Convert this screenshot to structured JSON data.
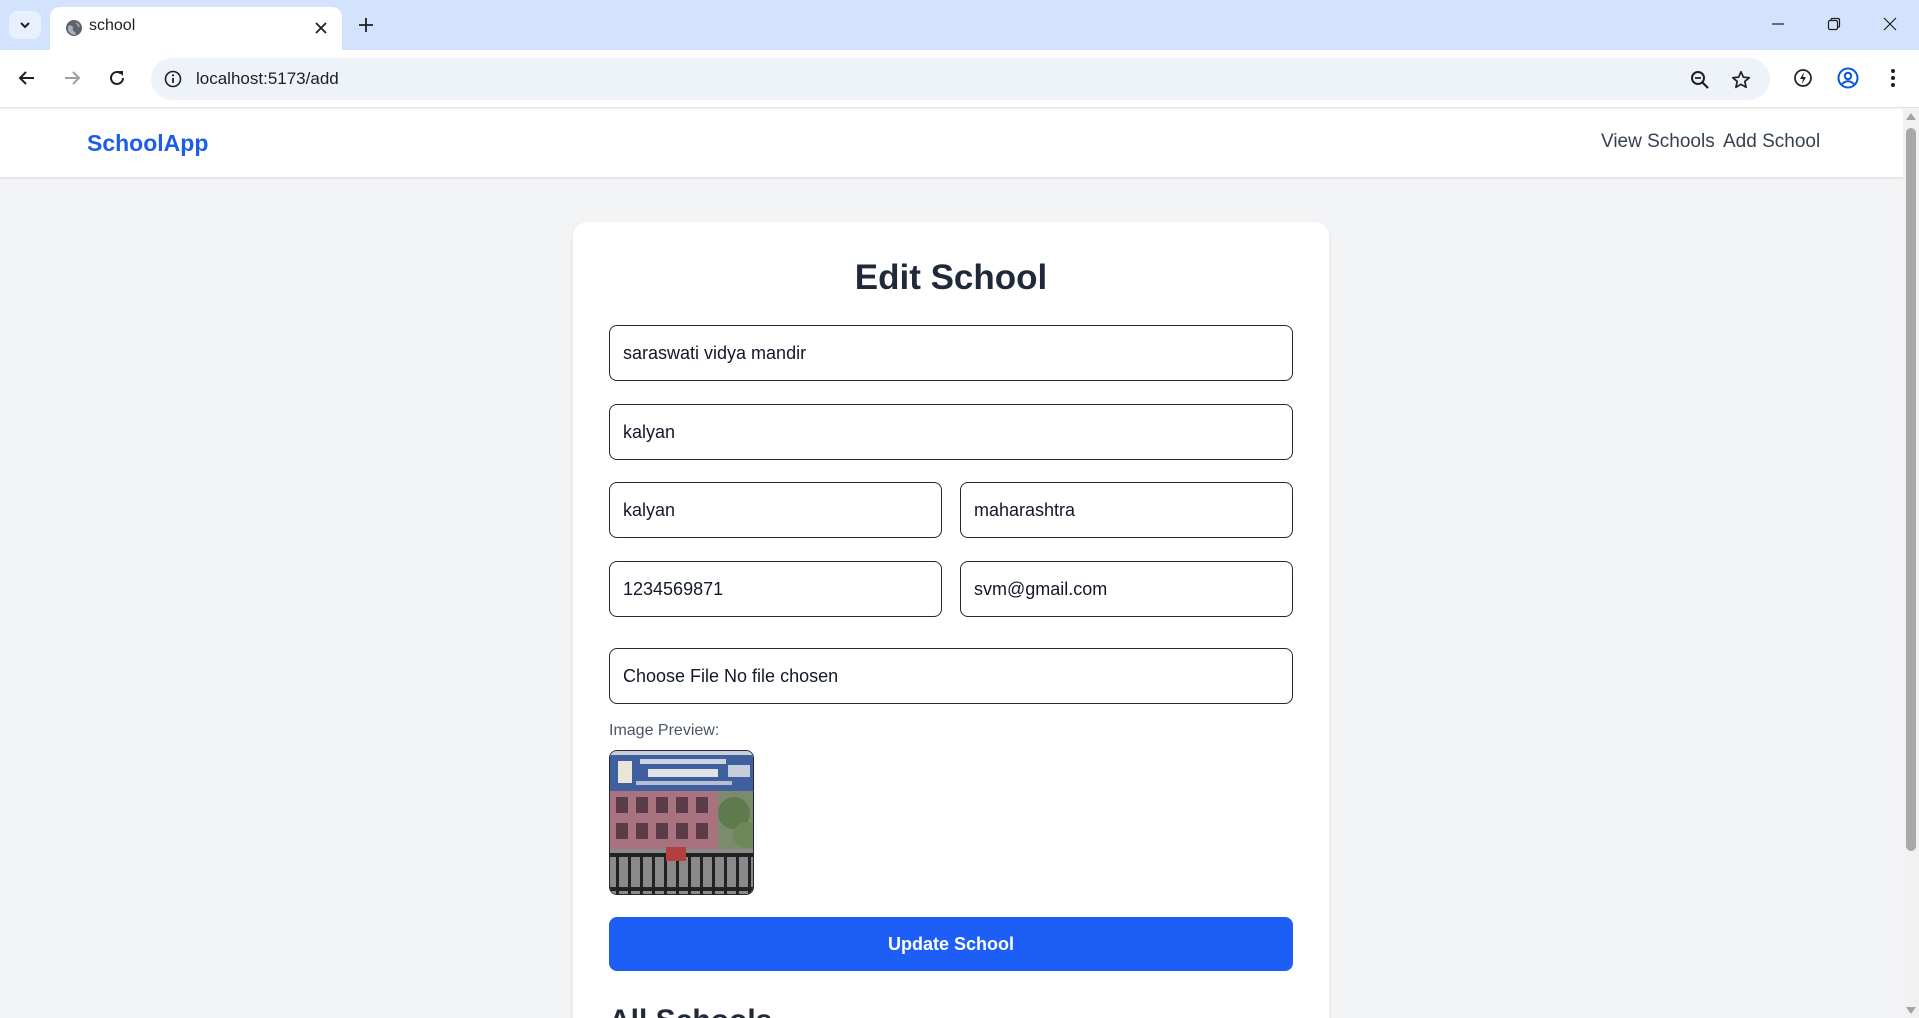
{
  "browser": {
    "tab_title": "school",
    "url": "localhost:5173/add",
    "icons": {
      "tab_search": "chevron-down-icon",
      "favicon": "globe-icon",
      "tab_close": "close-icon",
      "new_tab": "plus-icon",
      "back": "arrow-left-icon",
      "forward": "arrow-right-icon",
      "reload": "reload-icon",
      "site_info": "info-icon",
      "zoom": "zoom-out-icon",
      "bookmark": "star-icon",
      "extension": "performance-icon",
      "profile": "profile-icon",
      "menu": "kebab-menu-icon",
      "minimize": "minimize-icon",
      "restore": "restore-icon",
      "close_window": "close-icon"
    }
  },
  "app": {
    "brand": "SchoolApp",
    "nav_links": [
      "View Schools",
      "Add School"
    ]
  },
  "form": {
    "title": "Edit School",
    "name": "saraswati vidya mandir",
    "address": "kalyan",
    "city": "kalyan",
    "state": "maharashtra",
    "contact": "1234569871",
    "email": "svm@gmail.com",
    "file_button": "Choose File",
    "file_status": "No file chosen",
    "preview_label": "Image Preview:",
    "submit_label": "Update School"
  },
  "list": {
    "heading": "All Schools"
  },
  "colors": {
    "accent": "#1d5ef7",
    "brand": "#1d5ee8",
    "tabstrip": "#d3e3fd",
    "page_bg": "#f3f4f6"
  }
}
